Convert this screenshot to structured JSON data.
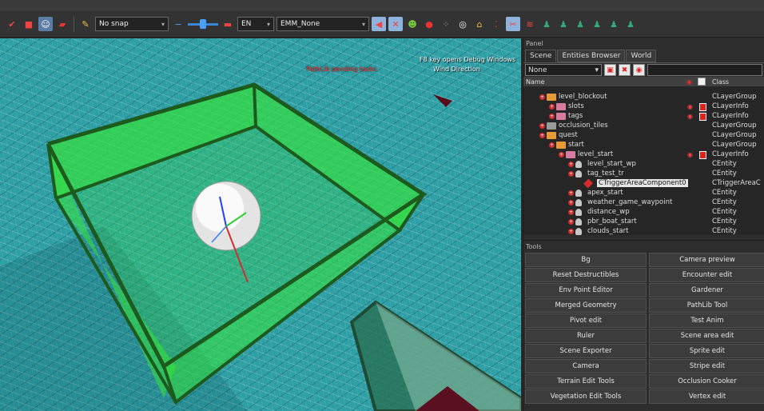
{
  "toolbar": {
    "snap_value": "No snap",
    "language_value": "EN",
    "material_value": "EMM_None"
  },
  "viewport": {
    "pathlib_label": "PathLib pending tasks",
    "f8_label": "F8 key opens Debug Windows",
    "wind_label": "Wind Direction"
  },
  "panel": {
    "title": "Panel",
    "tabs": [
      "Scene",
      "Entities Browser",
      "World"
    ],
    "filter_value": "None",
    "col_name": "Name",
    "col_class": "Class",
    "tree": [
      {
        "label": "level_blockout",
        "cls": "CLayerGroup",
        "indent": 0,
        "icon": "folder-orange",
        "eye": false
      },
      {
        "label": "slots",
        "cls": "CLayerInfo",
        "indent": 1,
        "icon": "layer-pink",
        "eye": true
      },
      {
        "label": "tags",
        "cls": "CLayerInfo",
        "indent": 1,
        "icon": "layer-pink",
        "eye": true
      },
      {
        "label": "occlusion_tiles",
        "cls": "CLayerGroup",
        "indent": 0,
        "icon": "folder-grey",
        "eye": false
      },
      {
        "label": "quest",
        "cls": "CLayerGroup",
        "indent": 0,
        "icon": "folder-orange",
        "eye": false
      },
      {
        "label": "start",
        "cls": "CLayerGroup",
        "indent": 1,
        "icon": "folder-orange",
        "eye": false
      },
      {
        "label": "level_start",
        "cls": "CLayerInfo",
        "indent": 2,
        "icon": "layer-pink",
        "eye": true
      },
      {
        "label": "level_start_wp",
        "cls": "CEntity",
        "indent": 3,
        "icon": "entity",
        "eye": false
      },
      {
        "label": "tag_test_tr",
        "cls": "CEntity",
        "indent": 3,
        "icon": "entity",
        "eye": false
      },
      {
        "label": "CTriggerAreaComponent0",
        "cls": "CTriggerAreaC",
        "indent": 4,
        "icon": "component",
        "eye": false,
        "selected": true
      },
      {
        "label": "apex_start",
        "cls": "CEntity",
        "indent": 3,
        "icon": "entity",
        "eye": false
      },
      {
        "label": "weather_game_waypoint",
        "cls": "CEntity",
        "indent": 3,
        "icon": "entity",
        "eye": false
      },
      {
        "label": "distance_wp",
        "cls": "CEntity",
        "indent": 3,
        "icon": "entity",
        "eye": false
      },
      {
        "label": "pbr_boat_start",
        "cls": "CEntity",
        "indent": 3,
        "icon": "entity",
        "eye": false
      },
      {
        "label": "clouds_start",
        "cls": "CEntity",
        "indent": 3,
        "icon": "entity",
        "eye": false
      }
    ]
  },
  "tools": {
    "title": "Tools",
    "buttons": [
      "Bg",
      "Camera preview",
      "Reset Destructibles",
      "Encounter edit",
      "Env Point Editor",
      "Gardener",
      "Merged Geometry",
      "PathLib Tool",
      "Pivot edit",
      "Test Anim",
      "Ruler",
      "Scene area edit",
      "Scene Exporter",
      "Sprite edit",
      "Camera",
      "Stripe edit",
      "Terrain Edit Tools",
      "Occlusion Cooker",
      "Vegetation Edit Tools",
      "Vertex edit"
    ]
  },
  "colors": {
    "water": "#2e9fa5",
    "trigger_green": "#35e035",
    "accent_red": "#d42b2b"
  }
}
